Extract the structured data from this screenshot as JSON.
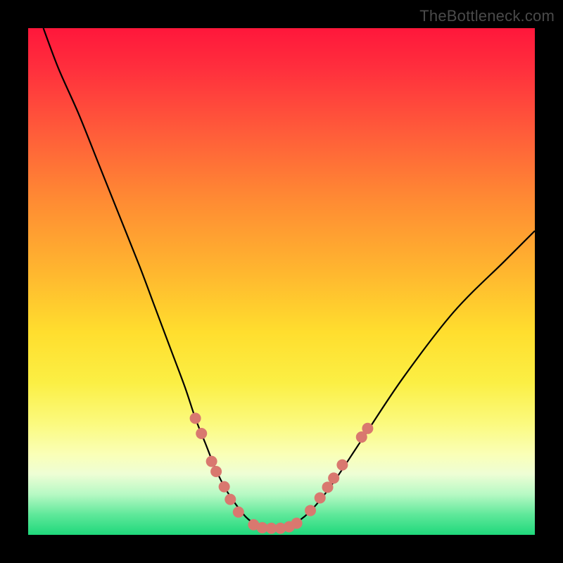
{
  "watermark": "TheBottleneck.com",
  "colors": {
    "background": "#000000",
    "curve": "#000000",
    "marker_fill": "#d9786f",
    "marker_stroke": "#b85d55"
  },
  "chart_data": {
    "type": "line",
    "title": "",
    "xlabel": "",
    "ylabel": "",
    "xlim": [
      0,
      100
    ],
    "ylim": [
      0,
      100
    ],
    "grid": false,
    "legend": false,
    "series": [
      {
        "name": "bottleneck-curve",
        "x": [
          3,
          6,
          10,
          14,
          18,
          22,
          25,
          28,
          31,
          33,
          35,
          37,
          39,
          41,
          43,
          45,
          47,
          50,
          53,
          56,
          60,
          66,
          74,
          84,
          94,
          100
        ],
        "y": [
          100,
          92,
          83,
          73,
          63,
          53,
          45,
          37,
          29,
          23,
          18,
          13,
          9,
          6,
          3.5,
          2,
          1.3,
          1.3,
          2.5,
          5,
          10,
          19,
          31,
          44,
          54,
          60
        ]
      }
    ],
    "markers": [
      {
        "x": 33.0,
        "y": 23.0
      },
      {
        "x": 34.2,
        "y": 20.0
      },
      {
        "x": 36.2,
        "y": 14.5
      },
      {
        "x": 37.1,
        "y": 12.5
      },
      {
        "x": 38.7,
        "y": 9.5
      },
      {
        "x": 39.9,
        "y": 7.0
      },
      {
        "x": 41.5,
        "y": 4.5
      },
      {
        "x": 44.5,
        "y": 2.0
      },
      {
        "x": 46.2,
        "y": 1.4
      },
      {
        "x": 48.0,
        "y": 1.3
      },
      {
        "x": 49.8,
        "y": 1.3
      },
      {
        "x": 51.5,
        "y": 1.6
      },
      {
        "x": 53.0,
        "y": 2.3
      },
      {
        "x": 55.7,
        "y": 4.8
      },
      {
        "x": 57.6,
        "y": 7.3
      },
      {
        "x": 59.1,
        "y": 9.4
      },
      {
        "x": 60.3,
        "y": 11.2
      },
      {
        "x": 62.0,
        "y": 13.8
      },
      {
        "x": 65.8,
        "y": 19.3
      },
      {
        "x": 67.0,
        "y": 21.0
      }
    ]
  }
}
